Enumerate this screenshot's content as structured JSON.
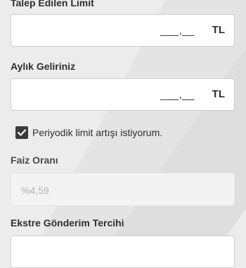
{
  "requested_limit": {
    "label": "Talep Edilen Limit",
    "mask": "___,__",
    "currency": "TL"
  },
  "monthly_income": {
    "label": "Aylık Geliriniz",
    "mask": "___,__",
    "currency": "TL"
  },
  "periodic_increase": {
    "label": "Periyodik limit artışı istiyorum.",
    "checked": true
  },
  "interest_rate": {
    "label": "Faiz Oranı",
    "value": "%4,59"
  },
  "statement_preference": {
    "label": "Ekstre Gönderim Tercihi"
  }
}
